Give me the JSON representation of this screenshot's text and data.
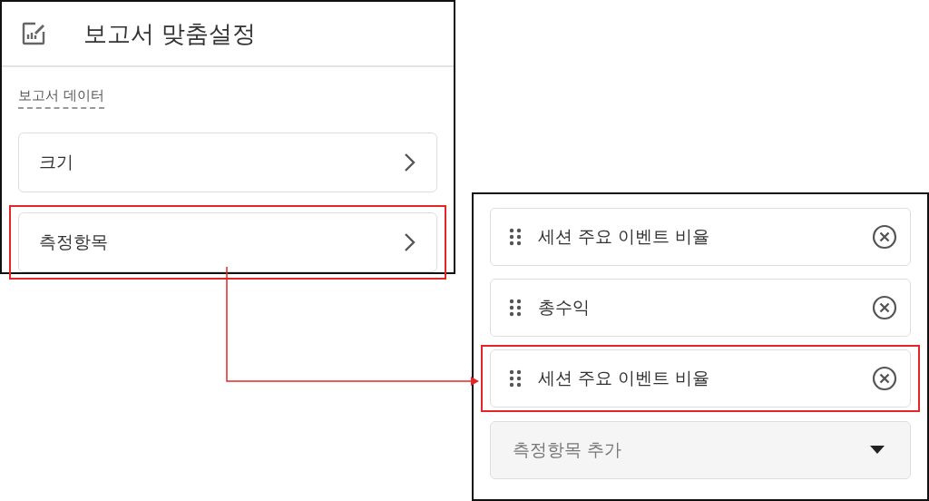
{
  "settings_panel": {
    "title": "보고서 맞춤설정",
    "section_label": "보고서 데이터",
    "items": [
      {
        "label": "크기",
        "highlighted": false
      },
      {
        "label": "측정항목",
        "highlighted": true
      }
    ]
  },
  "metrics_panel": {
    "metrics": [
      {
        "label": "세션 주요 이벤트 비율",
        "highlighted": false
      },
      {
        "label": "총수익",
        "highlighted": false
      },
      {
        "label": "세션 주요 이벤트 비율",
        "highlighted": true
      }
    ],
    "add_field": {
      "placeholder": "측정항목 추가"
    }
  }
}
